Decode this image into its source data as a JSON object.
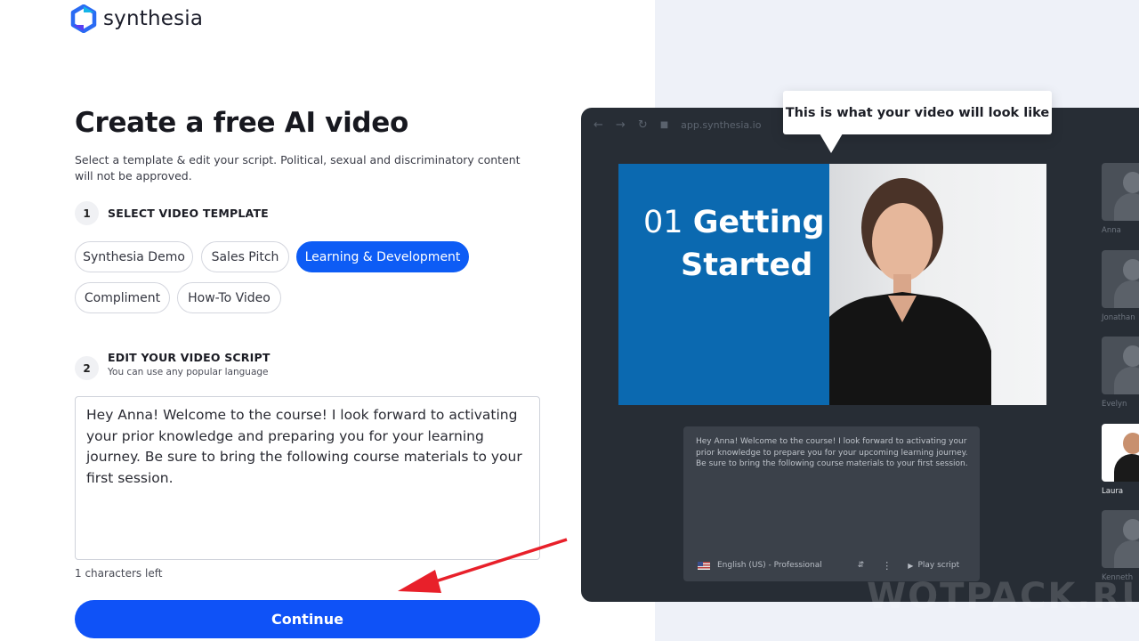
{
  "brand": {
    "name": "synthesia"
  },
  "form": {
    "title": "Create a free AI video",
    "subtitle": "Select a template & edit your script. Political, sexual and discriminatory content will not be approved.",
    "step1": {
      "number": "1",
      "title": "SELECT VIDEO TEMPLATE"
    },
    "templates": [
      {
        "label": "Synthesia Demo",
        "active": false
      },
      {
        "label": "Sales Pitch",
        "active": false
      },
      {
        "label": "Learning & Development",
        "active": true
      },
      {
        "label": "Compliment",
        "active": false
      },
      {
        "label": "How-To Video",
        "active": false
      }
    ],
    "step2": {
      "number": "2",
      "title": "EDIT YOUR VIDEO SCRIPT",
      "subtitle": "You can use any popular language"
    },
    "script": "Hey Anna! Welcome to the course! I look forward to activating your prior knowledge and preparing you for your learning journey. Be sure to bring the following course materials to your first session.",
    "chars_left": "1 characters left",
    "continue_label": "Continue"
  },
  "preview": {
    "tooltip": "This is what your video will look like",
    "url": "app.synthesia.io",
    "video_title_num": "01",
    "video_title_line1": "Getting",
    "video_title_line2": "Started",
    "script_preview": "Hey Anna! Welcome to the course! I look forward to activating your prior knowledge to prepare you for your upcoming learning journey. Be sure to bring the following course materials to your first session.",
    "language": "English (US) - Professional",
    "play_label": "Play script",
    "avatars": [
      {
        "name": "Anna",
        "active": false
      },
      {
        "name": "Jonathan",
        "active": false
      },
      {
        "name": "Evelyn",
        "active": false
      },
      {
        "name": "Laura",
        "active": true
      },
      {
        "name": "Kenneth",
        "active": false
      }
    ]
  },
  "watermark": "WOTPACK.RU",
  "colors": {
    "accent": "#0d5cf5",
    "button": "#0f52f7",
    "video_blue": "#0b69b0",
    "arrow": "#e8202a"
  }
}
